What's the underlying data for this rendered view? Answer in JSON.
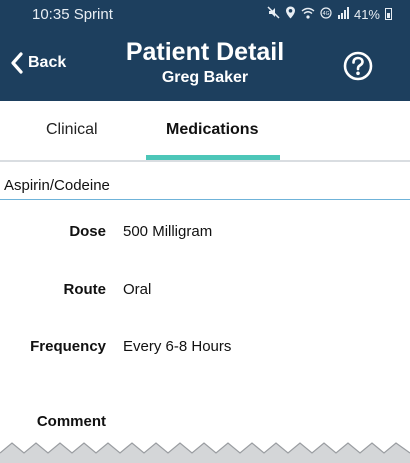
{
  "status_bar": {
    "time_carrier": "10:35 Sprint",
    "battery": "41%",
    "icons": [
      "mute-icon",
      "location-icon",
      "wifi-icon",
      "data-icon",
      "signal-icon",
      "battery-icon"
    ]
  },
  "header": {
    "back_label": "Back",
    "title": "Patient Detail",
    "subtitle": "Greg Baker",
    "help_icon": "question-circle-icon",
    "background_color": "#1d3f5e"
  },
  "tabs": [
    {
      "label": "Clinical",
      "selected": false
    },
    {
      "label": "Medications",
      "selected": true
    }
  ],
  "accent_color": "#4cc6b8",
  "medication": {
    "name": "Aspirin/Codeine",
    "fields": [
      {
        "label": "Dose",
        "value": "500 Milligram"
      },
      {
        "label": "Route",
        "value": "Oral"
      },
      {
        "label": "Frequency",
        "value": "Every 6-8 Hours"
      },
      {
        "label": "Comment",
        "value": ""
      }
    ]
  }
}
